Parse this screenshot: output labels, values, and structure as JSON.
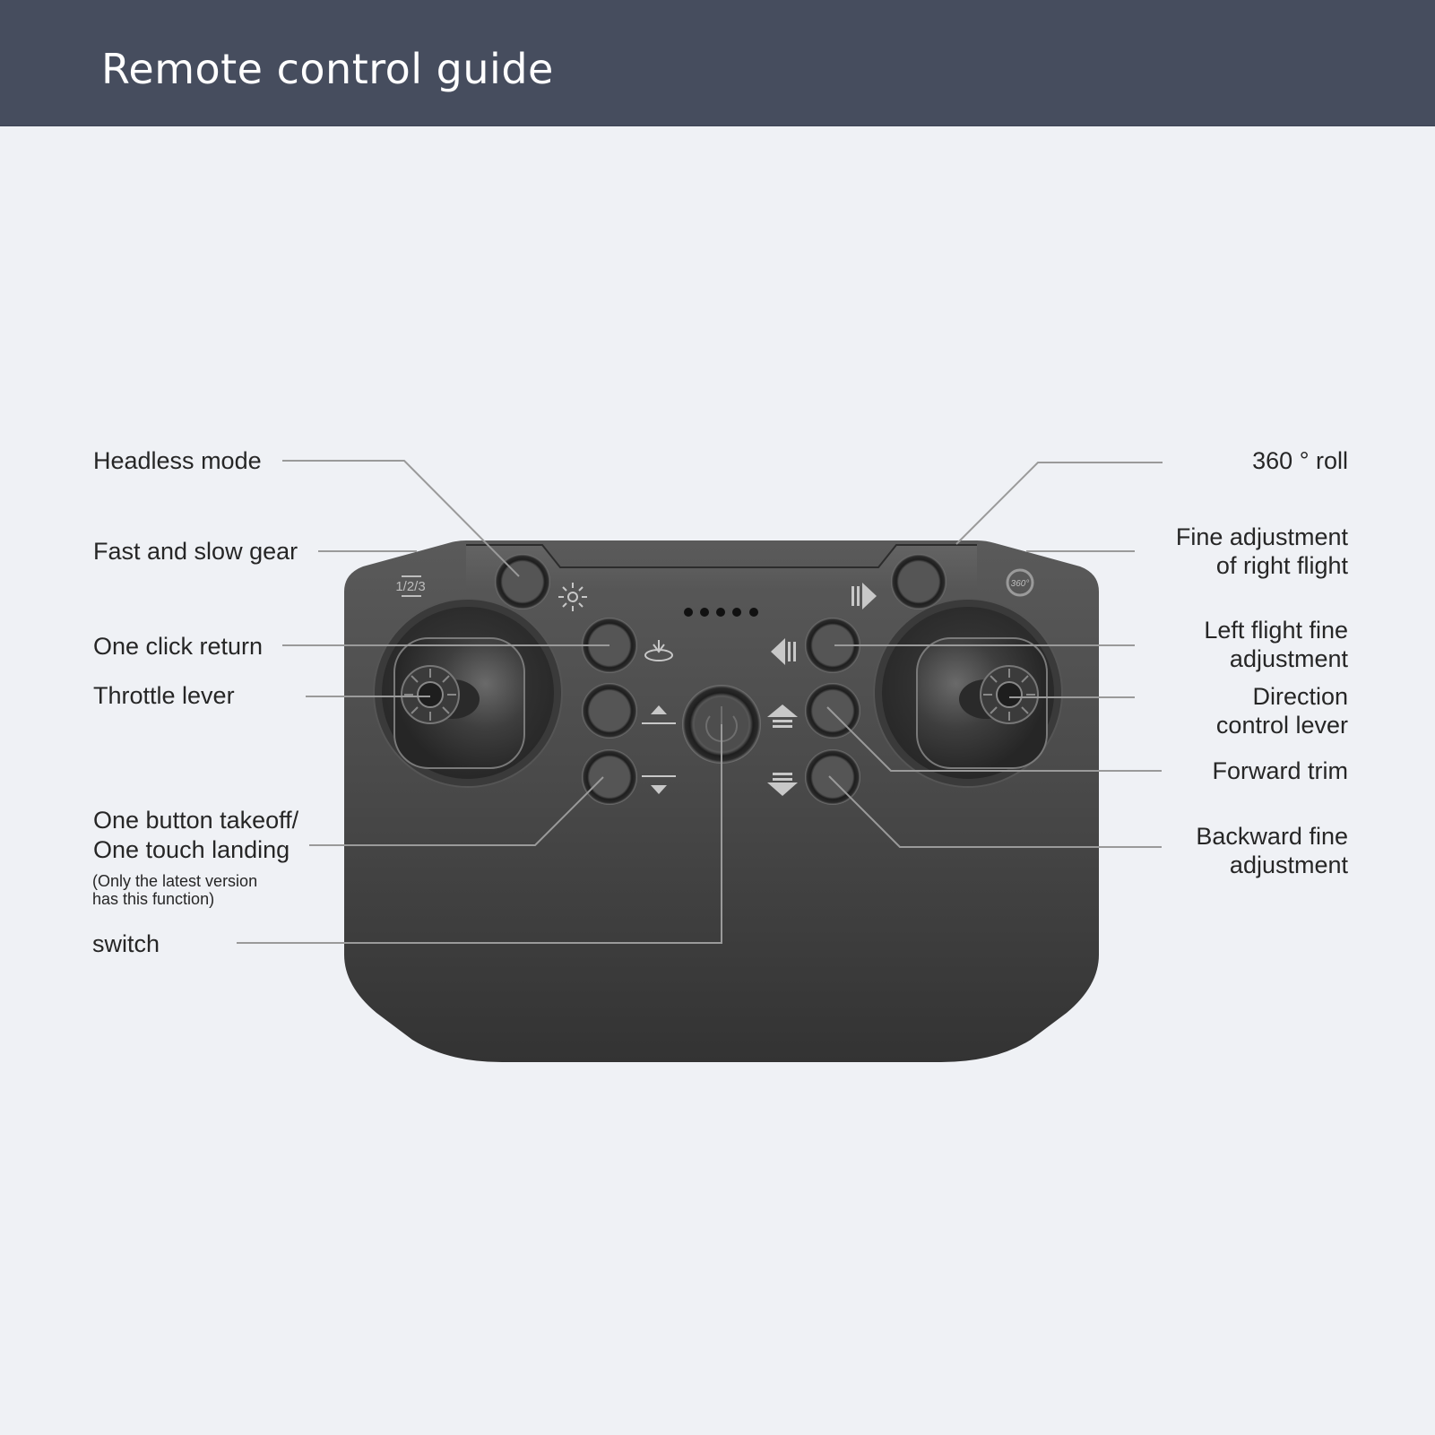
{
  "header": {
    "title": "Remote control guide"
  },
  "colors": {
    "header_bg": "#464d5e",
    "page_bg": "#eff1f5",
    "controller_body": "#474747",
    "leader_line": "#9a9a9a",
    "label_text": "#262626"
  },
  "labels_left": {
    "headless_mode": "Headless mode",
    "fast_slow_gear": "Fast and slow gear",
    "one_click_return": "One click return",
    "throttle_lever": "Throttle lever",
    "takeoff_line1": "One button takeoff/",
    "takeoff_line2": "One touch landing",
    "takeoff_note1": "(Only the latest version",
    "takeoff_note2": "has this function)",
    "switch": "switch"
  },
  "labels_right": {
    "roll_360": "360 ° roll",
    "fine_right_line1": "Fine adjustment",
    "fine_right_line2": "of right flight",
    "left_fine_line1": "Left flight fine",
    "left_fine_line2": "adjustment",
    "direction_line1": "Direction",
    "direction_line2": "control lever",
    "forward_trim": "Forward trim",
    "backward_line1": "Backward fine",
    "backward_line2": "adjustment"
  },
  "controller_markings": {
    "gear_icon_text": "1/2/3",
    "roll_icon_text": "360°",
    "indicator_dots": 5
  }
}
